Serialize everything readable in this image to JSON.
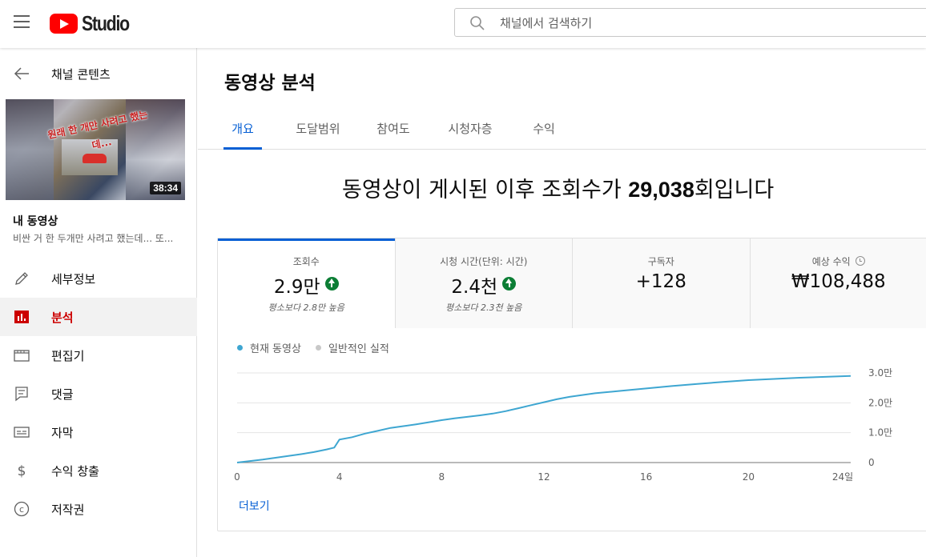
{
  "app": {
    "logo_text": "Studio",
    "logo_color": "#ff0000"
  },
  "search": {
    "placeholder": "채널에서 검색하기",
    "value": ""
  },
  "sidebar": {
    "back_label": "채널 콘텐츠",
    "thumbnail": {
      "banner_text": "원래 한 개만 사려고 했는데...",
      "duration": "38:34"
    },
    "section_title": "내 동영상",
    "video_title": "비싼 거 한 두개만 사려고 했는데... 또...",
    "items": [
      {
        "label": "세부정보",
        "icon": "pencil-icon"
      },
      {
        "label": "분석",
        "icon": "analytics-icon",
        "active": true
      },
      {
        "label": "편집기",
        "icon": "editor-icon"
      },
      {
        "label": "댓글",
        "icon": "comments-icon"
      },
      {
        "label": "자막",
        "icon": "subtitles-icon"
      },
      {
        "label": "수익 창출",
        "icon": "dollar-icon"
      },
      {
        "label": "저작권",
        "icon": "copyright-icon"
      }
    ]
  },
  "main": {
    "title": "동영상 분석",
    "tabs": [
      "개요",
      "도달범위",
      "참여도",
      "시청자층",
      "수익"
    ],
    "active_tab": 0,
    "headline_prefix": "동영상이 게시된 이후 조회수가 ",
    "headline_value": "29,038",
    "headline_suffix": "회입니다",
    "metrics": [
      {
        "label": "조회수",
        "value": "2.9만",
        "trend": "up",
        "sub": "평소보다 2.8만 높음"
      },
      {
        "label": "시청 시간(단위: 시간)",
        "value": "2.4천",
        "trend": "up",
        "sub": "평소보다 2.3천 높음"
      },
      {
        "label": "구독자",
        "value": "+128"
      },
      {
        "label": "예상 수익",
        "value": "₩108,488",
        "icon": "clock-icon"
      }
    ],
    "more_label": "더보기"
  },
  "colors": {
    "accent": "#065fd4",
    "active_nav": "#cc0000",
    "trend_up": "#0c7e35",
    "series_current": "#3ea6d1",
    "series_typical": "#cccccc"
  },
  "chart_data": {
    "type": "line",
    "series": [
      {
        "name": "현재 동영상",
        "x": [
          0,
          0.5,
          1,
          1.5,
          2,
          2.5,
          3,
          3.5,
          3.8,
          4,
          4.5,
          5,
          5.5,
          6,
          6.5,
          7,
          7.5,
          8,
          8.5,
          9,
          9.5,
          10,
          10.5,
          11,
          11.5,
          12,
          12.5,
          13,
          14,
          15,
          16,
          17,
          18,
          19,
          20,
          21,
          22,
          23,
          24
        ],
        "y": [
          0,
          0.05,
          0.1,
          0.16,
          0.22,
          0.28,
          0.35,
          0.44,
          0.5,
          0.77,
          0.85,
          0.97,
          1.06,
          1.16,
          1.22,
          1.28,
          1.35,
          1.42,
          1.48,
          1.53,
          1.58,
          1.64,
          1.72,
          1.82,
          1.92,
          2.02,
          2.12,
          2.2,
          2.32,
          2.4,
          2.48,
          2.56,
          2.63,
          2.7,
          2.76,
          2.8,
          2.84,
          2.87,
          2.9
        ]
      }
    ],
    "legend": [
      "현재 동영상",
      "일반적인 실적"
    ],
    "x_ticks": [
      "0",
      "4",
      "8",
      "12",
      "16",
      "20",
      "24일"
    ],
    "x_tick_values": [
      0,
      4,
      8,
      12,
      16,
      20,
      24
    ],
    "y_ticks": [
      "0",
      "1.0만",
      "2.0만",
      "3.0만"
    ],
    "y_tick_values": [
      0,
      1,
      2,
      3
    ],
    "ylim": [
      0,
      3
    ],
    "xlim": [
      0,
      24
    ],
    "grid": true,
    "y_axis_side": "right"
  }
}
